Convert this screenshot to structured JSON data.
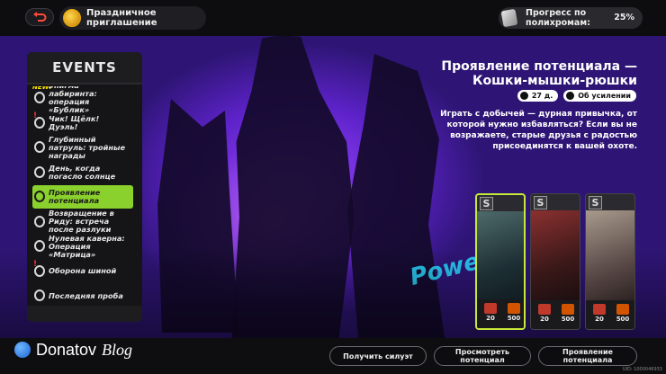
{
  "topbar": {
    "event_title": "Праздничное приглашение",
    "progress_label": "Прогресс по полихромам:",
    "progress_value": "25%"
  },
  "events": {
    "header": "EVENTS",
    "items": [
      {
        "label": "Энигма лабиринта: операция «Бублик»",
        "badge": "NEW!",
        "active": false
      },
      {
        "label": "Чик! Щёлк! Дуэль!",
        "badge": "!",
        "active": false
      },
      {
        "label": "Глубинный патруль: тройные награды",
        "badge": "",
        "active": false
      },
      {
        "label": "День, когда погасло солнце",
        "badge": "",
        "active": false
      },
      {
        "label": "Проявление потенциала",
        "badge": "",
        "active": true
      },
      {
        "label": "Возвращение в Риду: встреча после разлуки",
        "badge": "",
        "active": false
      },
      {
        "label": "Нулевая каверна: Операция «Матрица»",
        "badge": "",
        "active": false
      },
      {
        "label": "Оборона шиной",
        "badge": "!",
        "active": false
      },
      {
        "label": "Последняя проба",
        "badge": "",
        "active": false
      }
    ]
  },
  "detail": {
    "title": "Проявление потенциала — Кошки-мышки-рюшки",
    "days_left": "27 д.",
    "info_link": "Об усилении",
    "description": "Играть с добычей — дурная привычка, от которой нужно избавляться? Если вы не возражаете, старые друзья с радостью присоединятся к вашей охоте."
  },
  "watermark": "Powe",
  "cards": [
    {
      "rank": "S",
      "stat1": "20",
      "stat2": "500",
      "selected": true
    },
    {
      "rank": "S",
      "stat1": "20",
      "stat2": "500",
      "selected": false
    },
    {
      "rank": "S",
      "stat1": "20",
      "stat2": "500",
      "selected": false
    }
  ],
  "bottombar": {
    "logo_text": "Donatov",
    "logo_sub": "Blog",
    "btn_get_silhouette": "Получить силуэт",
    "btn_view_potential": "Просмотреть потенциал",
    "btn_manifest_potential": "Проявление потенциала",
    "uid": "UID: 1000046933"
  },
  "colors": {
    "accent": "#8bd12d",
    "bg_purple": "#6a38d8"
  }
}
